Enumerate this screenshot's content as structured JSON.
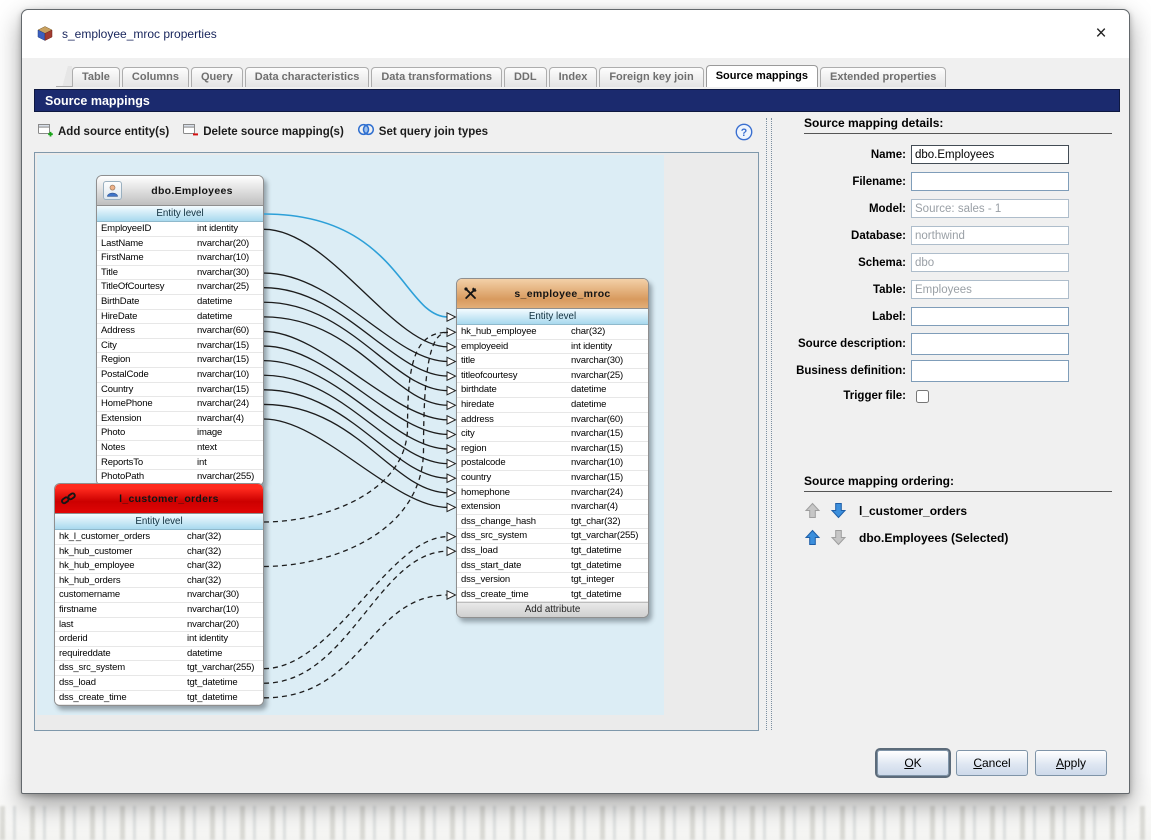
{
  "window": {
    "title": "s_employee_mroc properties",
    "close_glyph": "×"
  },
  "active_tab": "Source mappings",
  "tabs": [
    "Table",
    "Columns",
    "Query",
    "Data characteristics",
    "Data transformations",
    "DDL",
    "Index",
    "Foreign key join",
    "Source mappings",
    "Extended properties"
  ],
  "section_header": "Source mappings",
  "toolbar": {
    "add_label": "Add source entity(s)",
    "delete_label": "Delete source mapping(s)",
    "join_label": "Set query join types",
    "help_glyph": "?"
  },
  "colors": {
    "accent_navy": "#1b2a6e",
    "canvas_blue": "#dcedf5",
    "employees_header_gray": "#bfbfbf",
    "link_table_red": "#d90000",
    "staging_header_tan": "#d89a5e",
    "wire_blue": "#2da0d8",
    "wire_black": "#1c1c1c"
  },
  "entities": [
    {
      "id": "emp",
      "name": "dbo.Employees",
      "icon": "person-icon",
      "header": "gray",
      "entity_level_label": "Entity level",
      "rows": [
        [
          "EmployeeID",
          "int identity"
        ],
        [
          "LastName",
          "nvarchar(20)"
        ],
        [
          "FirstName",
          "nvarchar(10)"
        ],
        [
          "Title",
          "nvarchar(30)"
        ],
        [
          "TitleOfCourtesy",
          "nvarchar(25)"
        ],
        [
          "BirthDate",
          "datetime"
        ],
        [
          "HireDate",
          "datetime"
        ],
        [
          "Address",
          "nvarchar(60)"
        ],
        [
          "City",
          "nvarchar(15)"
        ],
        [
          "Region",
          "nvarchar(15)"
        ],
        [
          "PostalCode",
          "nvarchar(10)"
        ],
        [
          "Country",
          "nvarchar(15)"
        ],
        [
          "HomePhone",
          "nvarchar(24)"
        ],
        [
          "Extension",
          "nvarchar(4)"
        ],
        [
          "Photo",
          "image"
        ],
        [
          "Notes",
          "ntext"
        ],
        [
          "ReportsTo",
          "int"
        ],
        [
          "PhotoPath",
          "nvarchar(255)"
        ]
      ]
    },
    {
      "id": "lco",
      "name": "l_customer_orders",
      "icon": "link-icon",
      "header": "red",
      "entity_level_label": "Entity level",
      "rows": [
        [
          "hk_l_customer_orders",
          "char(32)"
        ],
        [
          "hk_hub_customer",
          "char(32)"
        ],
        [
          "hk_hub_employee",
          "char(32)"
        ],
        [
          "hk_hub_orders",
          "char(32)"
        ],
        [
          "customername",
          "nvarchar(30)"
        ],
        [
          "firstname",
          "nvarchar(10)"
        ],
        [
          "last",
          "nvarchar(20)"
        ],
        [
          "orderid",
          "int identity"
        ],
        [
          "requireddate",
          "datetime"
        ],
        [
          "dss_src_system",
          "tgt_varchar(255)"
        ],
        [
          "dss_load",
          "tgt_datetime"
        ],
        [
          "dss_create_time",
          "tgt_datetime"
        ]
      ]
    },
    {
      "id": "s",
      "name": "s_employee_mroc",
      "icon": "tools-icon",
      "header": "tan",
      "entity_level_label": "Entity level",
      "footer": "Add attribute",
      "rows": [
        [
          "hk_hub_employee",
          "char(32)"
        ],
        [
          "employeeid",
          "int identity"
        ],
        [
          "title",
          "nvarchar(30)"
        ],
        [
          "titleofcourtesy",
          "nvarchar(25)"
        ],
        [
          "birthdate",
          "datetime"
        ],
        [
          "hiredate",
          "datetime"
        ],
        [
          "address",
          "nvarchar(60)"
        ],
        [
          "city",
          "nvarchar(15)"
        ],
        [
          "region",
          "nvarchar(15)"
        ],
        [
          "postalcode",
          "nvarchar(10)"
        ],
        [
          "country",
          "nvarchar(15)"
        ],
        [
          "homephone",
          "nvarchar(24)"
        ],
        [
          "extension",
          "nvarchar(4)"
        ],
        [
          "dss_change_hash",
          "tgt_char(32)"
        ],
        [
          "dss_src_system",
          "tgt_varchar(255)"
        ],
        [
          "dss_load",
          "tgt_datetime"
        ],
        [
          "dss_start_date",
          "tgt_datetime"
        ],
        [
          "dss_version",
          "tgt_integer"
        ],
        [
          "dss_create_time",
          "tgt_datetime"
        ]
      ]
    }
  ],
  "connections": [
    {
      "from": "emp:__entity__",
      "to": "s:__entity__",
      "style": "blue",
      "d1": 135,
      "d2": 45
    },
    {
      "from": "emp:EmployeeID",
      "to": "s:employeeid",
      "style": "solid"
    },
    {
      "from": "emp:Title",
      "to": "s:title",
      "style": "solid"
    },
    {
      "from": "emp:TitleOfCourtesy",
      "to": "s:titleofcourtesy",
      "style": "solid"
    },
    {
      "from": "emp:BirthDate",
      "to": "s:birthdate",
      "style": "solid"
    },
    {
      "from": "emp:HireDate",
      "to": "s:hiredate",
      "style": "solid"
    },
    {
      "from": "emp:Address",
      "to": "s:address",
      "style": "solid"
    },
    {
      "from": "emp:City",
      "to": "s:city",
      "style": "solid"
    },
    {
      "from": "emp:Region",
      "to": "s:region",
      "style": "solid"
    },
    {
      "from": "emp:PostalCode",
      "to": "s:postalcode",
      "style": "solid"
    },
    {
      "from": "emp:Country",
      "to": "s:country",
      "style": "solid"
    },
    {
      "from": "emp:HomePhone",
      "to": "s:homephone",
      "style": "solid"
    },
    {
      "from": "emp:Extension",
      "to": "s:extension",
      "style": "solid"
    },
    {
      "from": "lco:__entity__",
      "to": "s:hk_hub_employee",
      "style": "dashed",
      "route": "loop",
      "xoff": 0
    },
    {
      "from": "lco:hk_hub_employee",
      "to": "s:hk_hub_employee",
      "style": "dashed",
      "route": "loop",
      "xoff": 16
    },
    {
      "from": "lco:dss_src_system",
      "to": "s:dss_src_system",
      "style": "dashed",
      "d1": 70,
      "d2": 60
    },
    {
      "from": "lco:dss_load",
      "to": "s:dss_load",
      "style": "dashed",
      "d1": 85,
      "d2": 70
    },
    {
      "from": "lco:dss_create_time",
      "to": "s:dss_create_time",
      "style": "dashed",
      "d1": 100,
      "d2": 80
    }
  ],
  "details": {
    "title": "Source mapping details:",
    "fields": [
      {
        "label": "Name:",
        "value": "dbo.Employees",
        "state": "editable",
        "first": true
      },
      {
        "label": "Filename:",
        "value": "",
        "state": "editable"
      },
      {
        "label": "Model:",
        "value": "Source: sales - 1",
        "state": "readonly"
      },
      {
        "label": "Database:",
        "value": "northwind",
        "state": "readonly"
      },
      {
        "label": "Schema:",
        "value": "dbo",
        "state": "readonly"
      },
      {
        "label": "Table:",
        "value": "Employees",
        "state": "readonly"
      },
      {
        "label": "Label:",
        "value": "",
        "state": "editable"
      },
      {
        "label": "Source description:",
        "value": "",
        "state": "editable",
        "tall": true
      },
      {
        "label": "Business definition:",
        "value": "",
        "state": "editable",
        "tall": true
      }
    ],
    "trigger_label": "Trigger file:",
    "trigger_checked": false
  },
  "ordering": {
    "title": "Source mapping ordering:",
    "items": [
      {
        "label": "l_customer_orders",
        "up": "gray",
        "down": "blue"
      },
      {
        "label": "dbo.Employees (Selected)",
        "up": "blue",
        "down": "gray"
      }
    ]
  },
  "buttons": [
    {
      "label": "OK",
      "mnemonic": "O",
      "default": true
    },
    {
      "label": "Cancel",
      "mnemonic": "C",
      "default": false
    },
    {
      "label": "Apply",
      "mnemonic": "A",
      "default": false
    }
  ]
}
